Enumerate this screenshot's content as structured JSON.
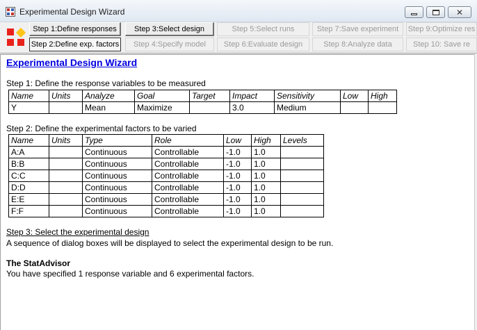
{
  "window": {
    "title": "Experimental Design Wizard"
  },
  "toolbar": {
    "buttons": [
      {
        "label": "Step 1:Define responses",
        "state": "enabled"
      },
      {
        "label": "Step 2:Define exp. factors",
        "state": "active"
      },
      {
        "label": "Step 3:Select design",
        "state": "enabled"
      },
      {
        "label": "Step 4:Specify model",
        "state": "disabled"
      },
      {
        "label": "Step 5:Select runs",
        "state": "disabled"
      },
      {
        "label": "Step 6:Evaluate design",
        "state": "disabled"
      },
      {
        "label": "Step 7:Save experiment",
        "state": "disabled"
      },
      {
        "label": "Step 8:Analyze data",
        "state": "disabled"
      },
      {
        "label": "Step 9:Optimize res",
        "state": "disabled"
      },
      {
        "label": "Step 10: Save re",
        "state": "disabled"
      }
    ]
  },
  "content": {
    "heading": "Experimental Design Wizard",
    "step1_title": "Step 1: Define the response variables to be measured",
    "responses_table": {
      "headers": [
        "Name",
        "Units",
        "Analyze",
        "Goal",
        "Target",
        "Impact",
        "Sensitivity",
        "Low",
        "High"
      ],
      "rows": [
        [
          "Y",
          "",
          "Mean",
          "Maximize",
          "",
          "3.0",
          "Medium",
          "",
          ""
        ]
      ]
    },
    "step2_title": "Step 2: Define the experimental factors to be varied",
    "factors_table": {
      "headers": [
        "Name",
        "Units",
        "Type",
        "Role",
        "Low",
        "High",
        "Levels"
      ],
      "rows": [
        [
          "A:A",
          "",
          "Continuous",
          "Controllable",
          "-1.0",
          "1.0",
          ""
        ],
        [
          "B:B",
          "",
          "Continuous",
          "Controllable",
          "-1.0",
          "1.0",
          ""
        ],
        [
          "C:C",
          "",
          "Continuous",
          "Controllable",
          "-1.0",
          "1.0",
          ""
        ],
        [
          "D:D",
          "",
          "Continuous",
          "Controllable",
          "-1.0",
          "1.0",
          ""
        ],
        [
          "E:E",
          "",
          "Continuous",
          "Controllable",
          "-1.0",
          "1.0",
          ""
        ],
        [
          "F:F",
          "",
          "Continuous",
          "Controllable",
          "-1.0",
          "1.0",
          ""
        ]
      ]
    },
    "step3_title": "Step 3: Select the experimental design",
    "step3_text": "A sequence of dialog boxes will be displayed to select the experimental design to be run.",
    "advisor_title": "The StatAdvisor",
    "advisor_text": "You have specified 1 response variable and 6 experimental factors."
  }
}
